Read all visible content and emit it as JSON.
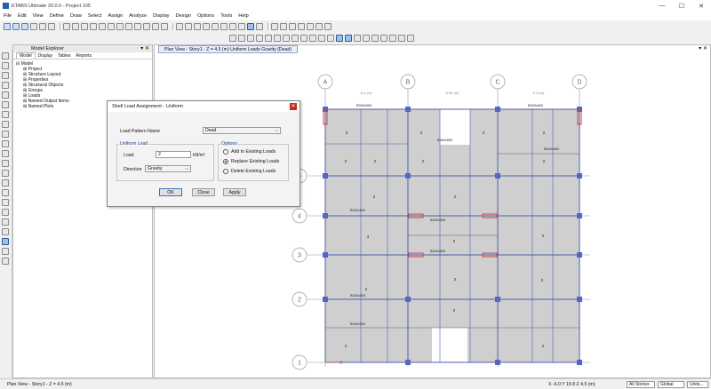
{
  "window": {
    "title": "ETABS Ultimate 20.0.0 - Project 105",
    "controls": [
      "—",
      "☐",
      "✕"
    ]
  },
  "menu": [
    "File",
    "Edit",
    "View",
    "Define",
    "Draw",
    "Select",
    "Assign",
    "Analyze",
    "Display",
    "Design",
    "Options",
    "Tools",
    "Help"
  ],
  "explorer": {
    "title": "Model Explorer",
    "tabs": [
      "Model",
      "Display",
      "Tables",
      "Reports"
    ],
    "tree": [
      {
        "label": "⊟ Model",
        "level": 0
      },
      {
        "label": "⊞ Project",
        "level": 1
      },
      {
        "label": "⊞ Structure Layout",
        "level": 1
      },
      {
        "label": "⊞ Properties",
        "level": 1
      },
      {
        "label": "⊞ Structural Objects",
        "level": 1
      },
      {
        "label": "⊞ Groups",
        "level": 1
      },
      {
        "label": "⊞ Loads",
        "level": 1
      },
      {
        "label": "⊞ Named Output Items",
        "level": 1
      },
      {
        "label": "⊞ Named Plots",
        "level": 1
      }
    ]
  },
  "view": {
    "tab": "Plan View - Story1 - Z = 4.5 (m)  Uniform Loads Gravity  (Dead)",
    "grid_x": [
      "A",
      "B",
      "C",
      "D"
    ],
    "grid_y": [
      "1",
      "2",
      "3",
      "4",
      "5"
    ],
    "spans_x": [
      "6.4 (m)",
      "6.95 (m)",
      "6.4 (m)"
    ],
    "beam_label": "B300x500",
    "slab_loads": [
      "2",
      "2",
      "2",
      "2",
      "2",
      "2",
      "2",
      "2",
      "2",
      "3",
      "2",
      "2",
      "2",
      "2",
      "2",
      "2",
      "2",
      "2",
      "2"
    ]
  },
  "dialog": {
    "title": "Shell Load Assignment - Uniform",
    "load_pattern_label": "Load Pattern Name",
    "load_pattern_value": "Dead",
    "uniform_group": "Uniform Load",
    "load_label": "Load",
    "load_value": "2",
    "load_unit": "kN/m²",
    "direction_label": "Direction",
    "direction_value": "Gravity",
    "options_group": "Options",
    "options": [
      "Add to Existing Loads",
      "Replace Existing Loads",
      "Delete Existing Loads"
    ],
    "selected_option": 1,
    "buttons": {
      "ok": "OK",
      "close": "Close",
      "apply": "Apply"
    }
  },
  "status": {
    "left": "Plan View - Story1 - Z = 4.5 (m)",
    "coords": "X -6.0  Y 19.8  Z 4.5 (m)",
    "stories": "All Stories",
    "system": "Global",
    "units": "Units..."
  },
  "colors": {
    "accent": "#2a5db0",
    "grid_line": "#8a96b8",
    "beam": "#4d5fa8",
    "column": "#5566c8",
    "release": "#d04040",
    "slab": "#cfcfcf"
  }
}
